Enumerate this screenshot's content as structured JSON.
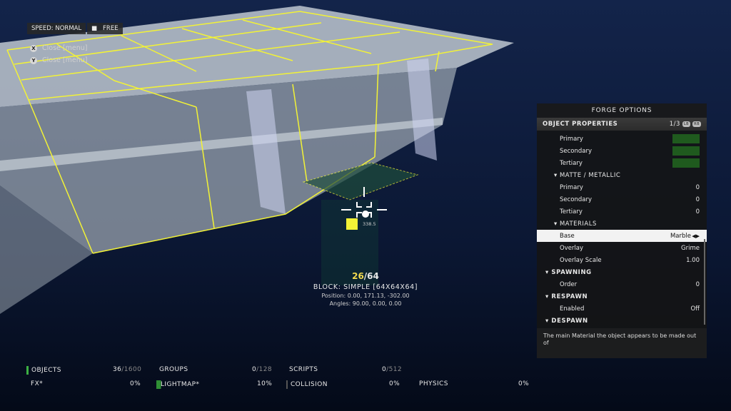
{
  "hud": {
    "speed": "SPEED: NORMAL",
    "camera_mode": "FREE",
    "hints": [
      {
        "button": "X",
        "label": "Close [menu]"
      },
      {
        "button": "Y",
        "label": "Close [menu]"
      }
    ],
    "reticle_value": "338.5"
  },
  "object_info": {
    "current": "26",
    "total": "/64",
    "name": "BLOCK: SIMPLE [64X64X64]",
    "position": "Position: 0.00, 171.13, -302.00",
    "angles": "Angles: 90.00, 0.00, 0.00"
  },
  "panel": {
    "title": "FORGE OPTIONS",
    "subtitle": "OBJECT PROPERTIES",
    "page": "1/3",
    "bumper_left": "LB",
    "bumper_right": "RB",
    "rows": [
      {
        "label": "Primary",
        "kind": "color"
      },
      {
        "label": "Secondary",
        "kind": "color"
      },
      {
        "label": "Tertiary",
        "kind": "color"
      },
      {
        "label": "▾ MATTE / METALLIC",
        "kind": "section"
      },
      {
        "label": "Primary",
        "value": "0"
      },
      {
        "label": "Secondary",
        "value": "0"
      },
      {
        "label": "Tertiary",
        "value": "0"
      },
      {
        "label": "▾ MATERIALS",
        "kind": "section"
      },
      {
        "label": "Base",
        "value": "Marble",
        "selected": true
      },
      {
        "label": "Overlay",
        "value": "Grime"
      },
      {
        "label": "Overlay Scale",
        "value": "1.00"
      },
      {
        "label": "▾ SPAWNING",
        "kind": "group"
      },
      {
        "label": "Order",
        "value": "0"
      },
      {
        "label": "▾ RESPAWN",
        "kind": "group"
      },
      {
        "label": "Enabled",
        "value": "Off"
      },
      {
        "label": "▾ DESPAWN",
        "kind": "group"
      }
    ],
    "description": "The main Material the object appears to be made out of",
    "swatch_color": "#1f5a1e"
  },
  "stats": {
    "objects_label": "OBJECTS",
    "objects_value": "36",
    "objects_max": "/1600",
    "groups_label": "GROUPS",
    "groups_value": "0",
    "groups_max": "/128",
    "scripts_label": "SCRIPTS",
    "scripts_value": "0",
    "scripts_max": "/512",
    "fx_label": "FX*",
    "fx_value": "0%",
    "lightmap_label": "LIGHTMAP*",
    "lightmap_value": "10%",
    "collision_label": "COLLISION",
    "collision_value": "0%",
    "physics_label": "PHYSICS",
    "physics_value": "0%"
  },
  "colors": {
    "highlight": "#f2f236",
    "accent_green": "#3cb043",
    "counter_yellow": "#f2d94e"
  }
}
